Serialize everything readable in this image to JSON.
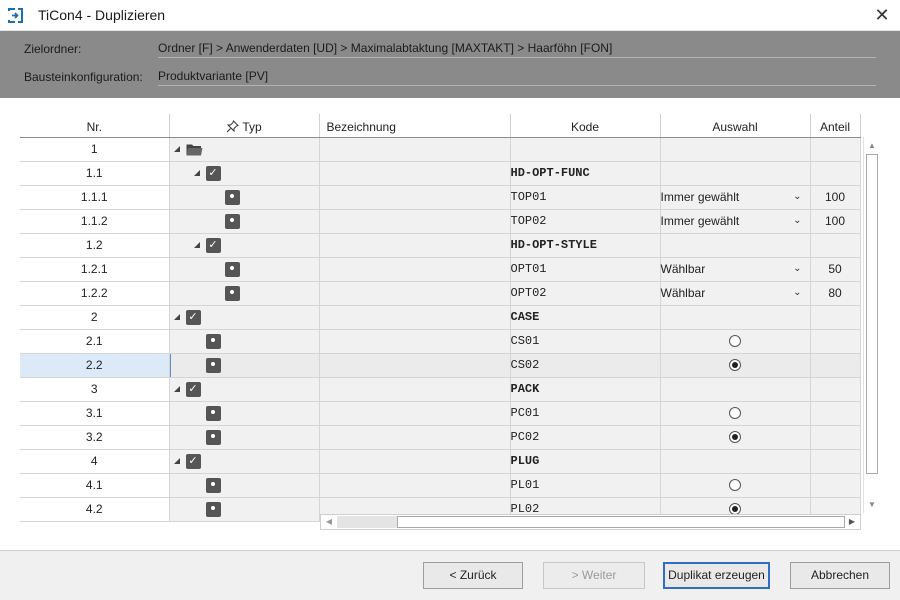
{
  "window": {
    "title": "TiCon4 - Duplizieren",
    "close_label": "✕"
  },
  "info": {
    "zielordner_label": "Zielordner:",
    "zielordner_value": "Ordner [F] > Anwenderdaten [UD] > Maximalabtaktung [MAXTAKT] > Haarföhn [FON]",
    "baustein_label": "Bausteinkonfiguration:",
    "baustein_value": "Produktvariante [PV]"
  },
  "grid": {
    "columns": {
      "nr": "Nr.",
      "typ": "Typ",
      "bezeichnung": "Bezeichnung",
      "kode": "Kode",
      "auswahl": "Auswahl",
      "anteil": "Anteil"
    },
    "rows": [
      {
        "nr": "1",
        "level": 0,
        "kind": "folder",
        "bez": "",
        "kode": "",
        "bold": false,
        "ausw": "",
        "dropdown": false,
        "radio": "",
        "anteil": ""
      },
      {
        "nr": "1.1",
        "level": 1,
        "kind": "check",
        "bez": "",
        "kode": "HD-OPT-FUNC",
        "bold": true,
        "ausw": "",
        "dropdown": false,
        "radio": "",
        "anteil": ""
      },
      {
        "nr": "1.1.1",
        "level": 2,
        "kind": "leaf",
        "bez": "",
        "kode": "TOP01",
        "bold": false,
        "ausw": "Immer gewählt",
        "dropdown": true,
        "radio": "",
        "anteil": "100"
      },
      {
        "nr": "1.1.2",
        "level": 2,
        "kind": "leaf",
        "bez": "",
        "kode": "TOP02",
        "bold": false,
        "ausw": "Immer gewählt",
        "dropdown": true,
        "radio": "",
        "anteil": "100"
      },
      {
        "nr": "1.2",
        "level": 1,
        "kind": "check",
        "bez": "",
        "kode": "HD-OPT-STYLE",
        "bold": true,
        "ausw": "",
        "dropdown": false,
        "radio": "",
        "anteil": ""
      },
      {
        "nr": "1.2.1",
        "level": 2,
        "kind": "leaf",
        "bez": "",
        "kode": "OPT01",
        "bold": false,
        "ausw": "Wählbar",
        "dropdown": true,
        "radio": "",
        "anteil": "50"
      },
      {
        "nr": "1.2.2",
        "level": 2,
        "kind": "leaf",
        "bez": "",
        "kode": "OPT02",
        "bold": false,
        "ausw": "Wählbar",
        "dropdown": true,
        "radio": "",
        "anteil": "80"
      },
      {
        "nr": "2",
        "level": 0,
        "kind": "check",
        "bez": "",
        "kode": "CASE",
        "bold": true,
        "ausw": "",
        "dropdown": false,
        "radio": "",
        "anteil": ""
      },
      {
        "nr": "2.1",
        "level": 1,
        "kind": "leaf",
        "bez": "",
        "kode": "CS01",
        "bold": false,
        "ausw": "",
        "dropdown": false,
        "radio": "off",
        "anteil": ""
      },
      {
        "nr": "2.2",
        "level": 1,
        "kind": "leaf",
        "bez": "",
        "kode": "CS02",
        "bold": false,
        "ausw": "",
        "dropdown": false,
        "radio": "on",
        "anteil": "",
        "selected": true
      },
      {
        "nr": "3",
        "level": 0,
        "kind": "check",
        "bez": "",
        "kode": "PACK",
        "bold": true,
        "ausw": "",
        "dropdown": false,
        "radio": "",
        "anteil": ""
      },
      {
        "nr": "3.1",
        "level": 1,
        "kind": "leaf",
        "bez": "",
        "kode": "PC01",
        "bold": false,
        "ausw": "",
        "dropdown": false,
        "radio": "off",
        "anteil": ""
      },
      {
        "nr": "3.2",
        "level": 1,
        "kind": "leaf",
        "bez": "",
        "kode": "PC02",
        "bold": false,
        "ausw": "",
        "dropdown": false,
        "radio": "on",
        "anteil": ""
      },
      {
        "nr": "4",
        "level": 0,
        "kind": "check",
        "bez": "",
        "kode": "PLUG",
        "bold": true,
        "ausw": "",
        "dropdown": false,
        "radio": "",
        "anteil": ""
      },
      {
        "nr": "4.1",
        "level": 1,
        "kind": "leaf",
        "bez": "",
        "kode": "PL01",
        "bold": false,
        "ausw": "",
        "dropdown": false,
        "radio": "off",
        "anteil": ""
      },
      {
        "nr": "4.2",
        "level": 1,
        "kind": "leaf",
        "bez": "",
        "kode": "PL02",
        "bold": false,
        "ausw": "",
        "dropdown": false,
        "radio": "on",
        "anteil": ""
      }
    ]
  },
  "buttons": {
    "back": "< Zurück",
    "next": "> Weiter",
    "create": "Duplikat erzeugen",
    "cancel": "Abbrechen"
  },
  "colors": {
    "info_panel": "#8a8a8a",
    "selected_row": "#dce9f7",
    "primary_border": "#2f6ec0"
  }
}
